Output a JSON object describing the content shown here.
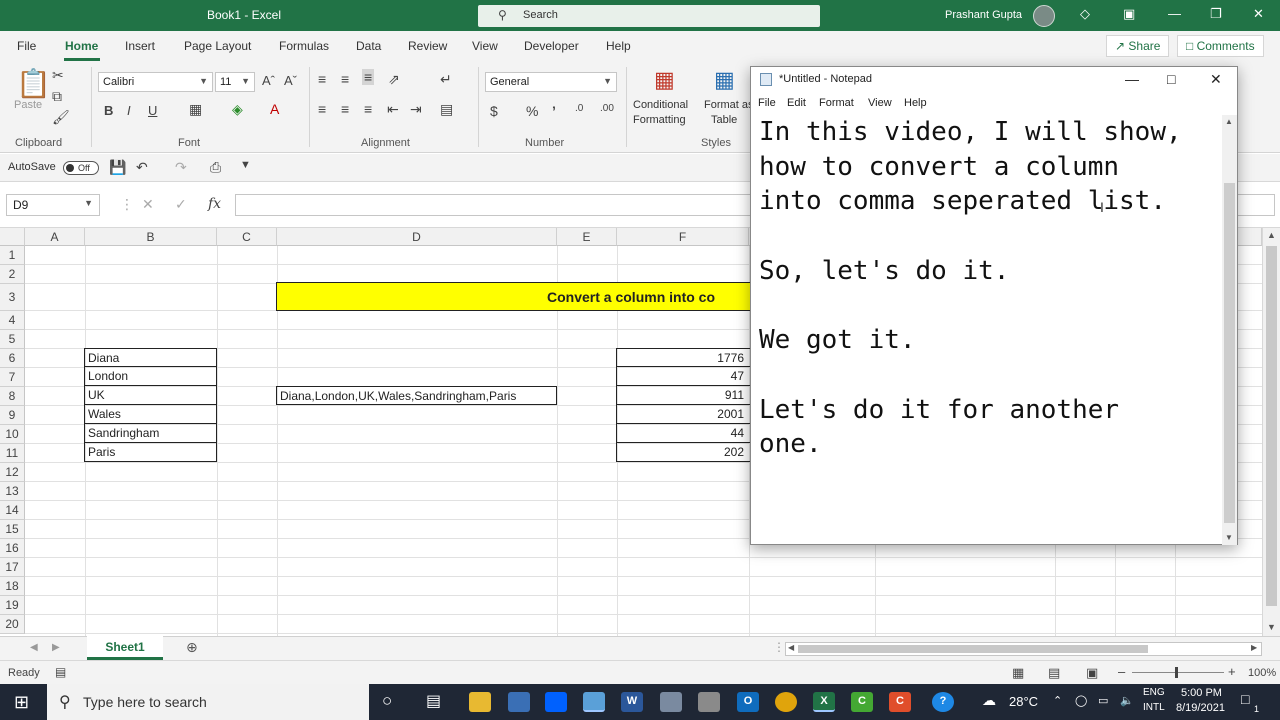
{
  "excel": {
    "window_title": "Book1 - Excel",
    "search_placeholder": "Search",
    "user_name": "Prashant Gupta",
    "menu": [
      "File",
      "Home",
      "Insert",
      "Page Layout",
      "Formulas",
      "Data",
      "Review",
      "View",
      "Developer",
      "Help"
    ],
    "share_label": "Share",
    "comments_label": "Comments",
    "ribbon": {
      "paste_label": "Paste",
      "font_name": "Calibri",
      "font_size": "11",
      "number_format": "General",
      "conditional_formatting_1": "Conditional",
      "conditional_formatting_2": "Formatting",
      "format_as_table_1": "Format as",
      "format_as_table_2": "Table",
      "groups": [
        "Clipboard",
        "Font",
        "Alignment",
        "Number",
        "Styles"
      ]
    },
    "qat": {
      "autosave_label": "AutoSave",
      "autosave_state": "Off"
    },
    "name_box": "D9",
    "formula_buttons": [
      "✕",
      "✓",
      "fx"
    ],
    "columns": [
      "A",
      "B",
      "C",
      "D",
      "E",
      "F",
      "G"
    ],
    "rows": [
      "1",
      "2",
      "3",
      "4",
      "5",
      "6",
      "7",
      "8",
      "9",
      "10",
      "11",
      "12",
      "13",
      "14",
      "15",
      "16",
      "17",
      "18",
      "19",
      "20"
    ],
    "cells": {
      "banner_D3": "Convert a column into co",
      "B": [
        "Diana",
        "London",
        "UK",
        "Wales",
        "Sandringham",
        "Paris"
      ],
      "D8": "Diana,London,UK,Wales,Sandringham,Paris",
      "F": [
        "1776",
        "47",
        "911",
        "2001",
        "44",
        "202"
      ]
    },
    "sheet_tab": "Sheet1",
    "status_text": "Ready",
    "zoom": "100%",
    "colors": {
      "excel_green": "#217346",
      "banner_yellow": "#ffff00"
    }
  },
  "notepad": {
    "title": "*Untitled - Notepad",
    "menu": [
      "File",
      "Edit",
      "Format",
      "View",
      "Help"
    ],
    "lines": [
      "In this video, I will show,",
      "how to convert a column",
      "into comma seperated list.",
      "",
      "So, let's do it.",
      "",
      "We got it.",
      "",
      "Let's do it for another",
      "one."
    ]
  },
  "taskbar": {
    "search_placeholder": "Type here to search",
    "temperature": "28°C",
    "language_1": "ENG",
    "language_2": "INTL",
    "time": "5:00 PM",
    "date": "8/19/2021",
    "notification_count": "1"
  }
}
